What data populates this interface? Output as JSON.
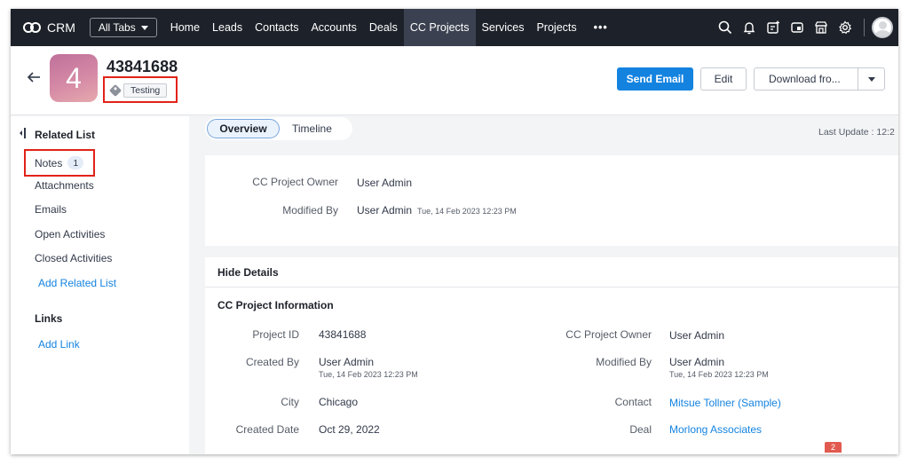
{
  "topnav": {
    "brand": "CRM",
    "all_tabs": "All Tabs",
    "tabs": [
      {
        "label": "Home"
      },
      {
        "label": "Leads"
      },
      {
        "label": "Contacts"
      },
      {
        "label": "Accounts"
      },
      {
        "label": "Deals"
      },
      {
        "label": "CC Projects"
      },
      {
        "label": "Services"
      },
      {
        "label": "Projects"
      }
    ],
    "more": "•••",
    "active_tab": "CC Projects",
    "icons": [
      "search-icon",
      "bell-icon",
      "calendar-add-icon",
      "window-icon",
      "marketplace-icon",
      "gear-icon",
      "user-avatar"
    ]
  },
  "record": {
    "avatar_letter": "4",
    "title": "43841688",
    "tag": "Testing",
    "buttons": {
      "send_email": "Send Email",
      "edit": "Edit",
      "download": "Download fro..."
    }
  },
  "sidebar": {
    "related_list_heading": "Related List",
    "notes": {
      "label": "Notes",
      "count": "1"
    },
    "items": [
      {
        "label": "Attachments"
      },
      {
        "label": "Emails"
      },
      {
        "label": "Open Activities"
      },
      {
        "label": "Closed Activities"
      }
    ],
    "add_related_list": "Add Related List",
    "links_heading": "Links",
    "add_link": "Add Link"
  },
  "main": {
    "tabs": [
      {
        "label": "Overview"
      },
      {
        "label": "Timeline"
      }
    ],
    "last_update": "Last Update : 12:2",
    "summary": {
      "owner_label": "CC Project Owner",
      "owner_value": "User Admin",
      "modified_label": "Modified By",
      "modified_value": "User Admin",
      "modified_time": "Tue, 14 Feb 2023 12:23 PM"
    },
    "details": {
      "toggle": "Hide Details",
      "section": "CC Project Information",
      "left": [
        {
          "label": "Project ID",
          "value": "43841688"
        },
        {
          "label": "Created By",
          "value": "User Admin",
          "sub": "Tue, 14 Feb 2023 12:23 PM"
        },
        {
          "label": "City",
          "value": "Chicago"
        },
        {
          "label": "Created Date",
          "value": "Oct 29, 2022"
        }
      ],
      "right": [
        {
          "label": "CC Project Owner",
          "value": "User Admin"
        },
        {
          "label": "Modified By",
          "value": "User Admin",
          "sub": "Tue, 14 Feb 2023 12:23 PM"
        },
        {
          "label": "Contact",
          "value": "Mitsue Tollner (Sample)"
        },
        {
          "label": "Deal",
          "value": "Morlong Associates"
        }
      ]
    },
    "badge": "2"
  },
  "colors": {
    "nav_bg": "#1d2129",
    "primary": "#1483e0",
    "highlight_box": "#e12318"
  }
}
